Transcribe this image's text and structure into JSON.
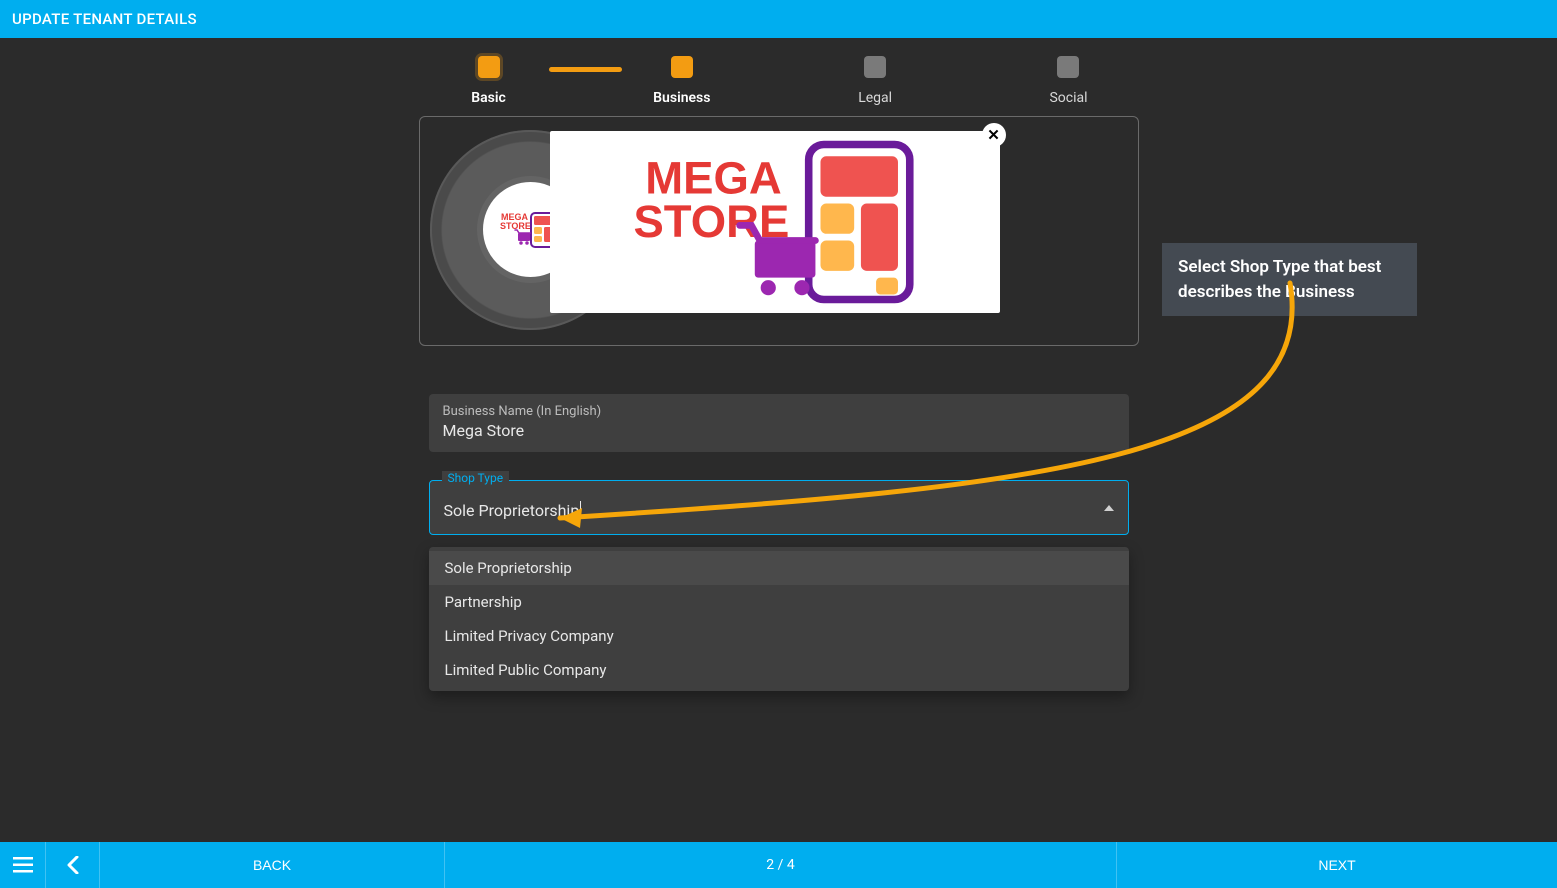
{
  "header": {
    "title": "UPDATE TENANT DETAILS"
  },
  "stepper": {
    "steps": [
      {
        "label": "Basic",
        "state": "done"
      },
      {
        "label": "Business",
        "state": "active"
      },
      {
        "label": "Legal",
        "state": "pending"
      },
      {
        "label": "Social",
        "state": "pending"
      }
    ]
  },
  "brand": {
    "logo_text_line1": "MEGA",
    "logo_text_line2": "STORE"
  },
  "form": {
    "business_name": {
      "label": "Business Name (In English)",
      "value": "Mega Store"
    },
    "shop_type": {
      "label": "Shop Type",
      "value": "Sole Proprietorship",
      "options": [
        "Sole Proprietorship",
        "Partnership",
        "Limited Privacy Company",
        "Limited Public Company"
      ]
    }
  },
  "tooltip": {
    "text": "Select Shop Type that best describes the Business"
  },
  "footer": {
    "back": "BACK",
    "next": "NEXT",
    "progress": "2 / 4"
  }
}
